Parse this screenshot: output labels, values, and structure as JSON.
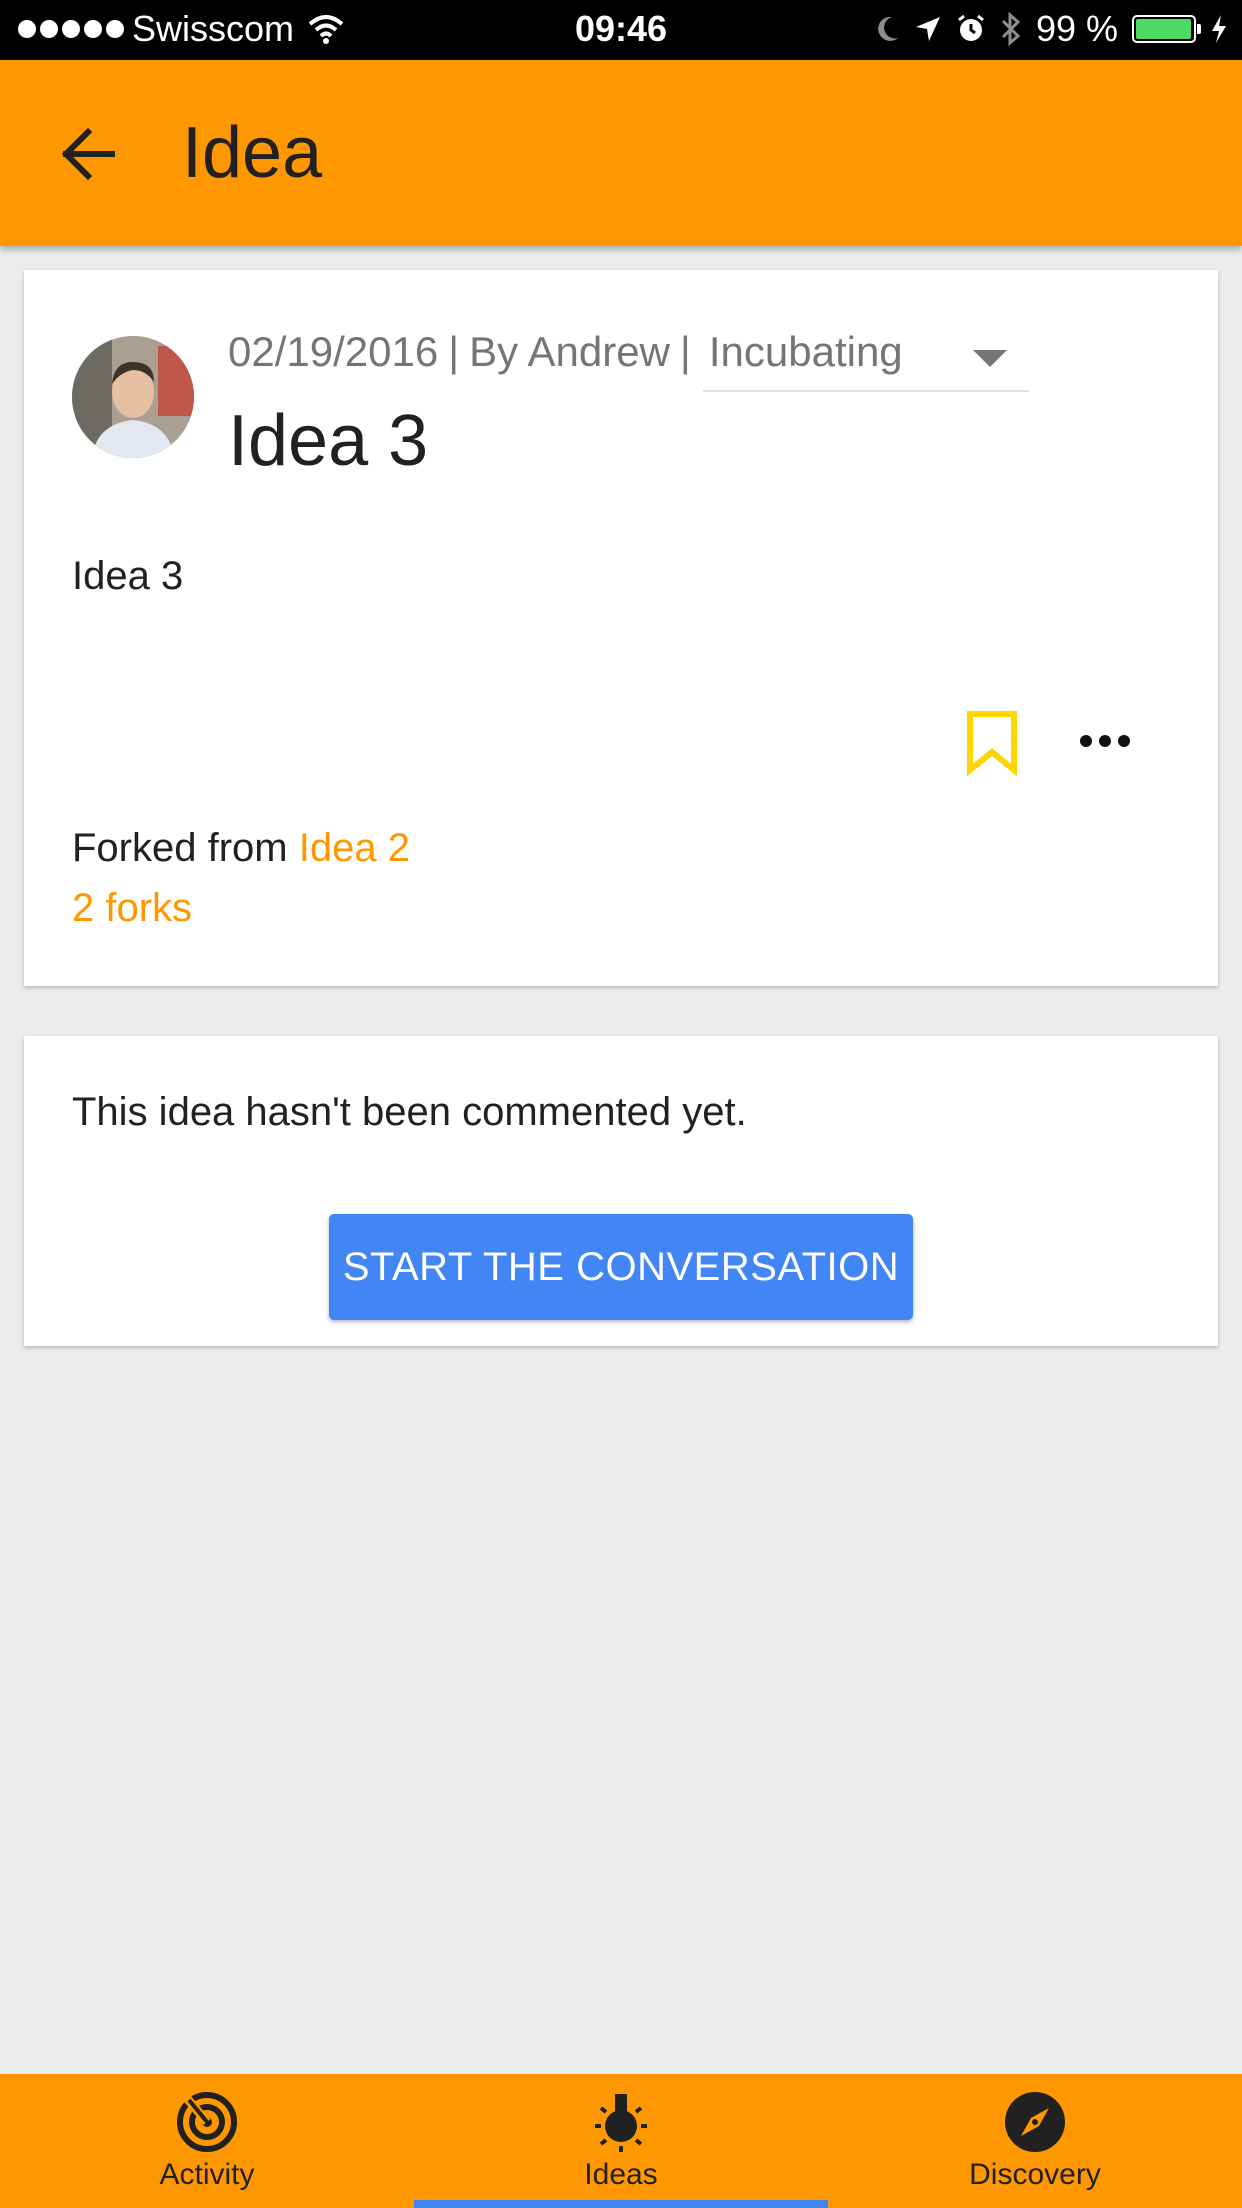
{
  "status_bar": {
    "carrier": "Swisscom",
    "time": "09:46",
    "battery": "99 %",
    "battery_level": 0.99
  },
  "app_bar": {
    "title": "Idea",
    "back_icon": "arrow-back-icon"
  },
  "idea": {
    "date": "02/19/2016",
    "author_prefix": "By Andrew",
    "separator": "|",
    "status": "Incubating",
    "title": "Idea 3",
    "body": "Idea 3",
    "forked_from_label": "Forked from",
    "forked_from_link": "Idea 2",
    "forks": "2 forks",
    "bookmark_color": "#ffd600"
  },
  "comments": {
    "empty_text": "This idea hasn't been commented yet.",
    "start_button": "START THE CONVERSATION"
  },
  "bottom_nav": {
    "items": [
      {
        "label": "Activity",
        "icon": "activity-icon"
      },
      {
        "label": "Ideas",
        "icon": "lightbulb-icon"
      },
      {
        "label": "Discovery",
        "icon": "compass-icon"
      }
    ],
    "active": "Ideas"
  },
  "colors": {
    "primary": "#ff9800",
    "accent": "#4285f4",
    "background": "#ececec"
  }
}
